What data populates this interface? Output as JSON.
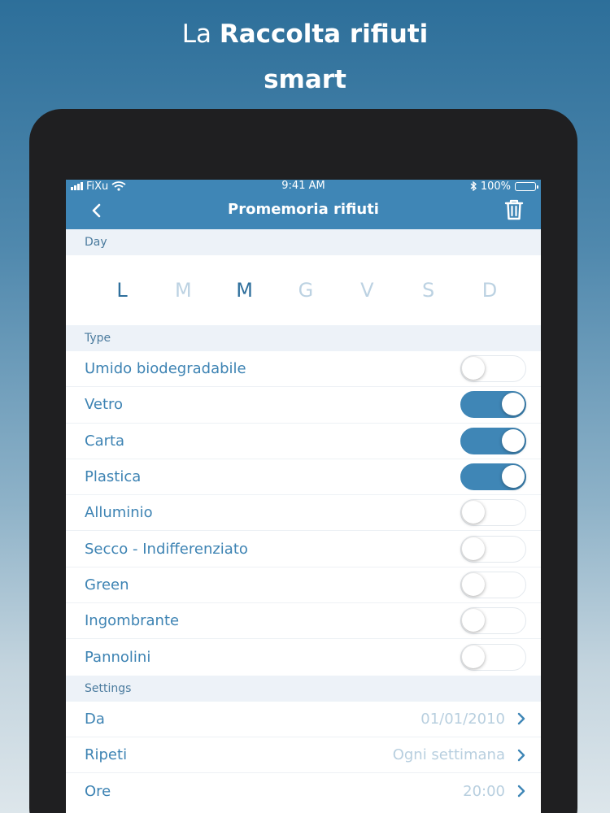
{
  "headline": {
    "light": "La",
    "bold": "Raccolta rifiuti",
    "line2": "smart"
  },
  "status": {
    "carrier": "FiXu",
    "time": "9:41 AM",
    "battery": "100%"
  },
  "nav": {
    "title": "Promemoria rifiuti"
  },
  "sections": {
    "day": "Day",
    "type": "Type",
    "settings": "Settings"
  },
  "days": [
    {
      "letter": "L",
      "active": true
    },
    {
      "letter": "M",
      "active": false
    },
    {
      "letter": "M",
      "active": true
    },
    {
      "letter": "G",
      "active": false
    },
    {
      "letter": "V",
      "active": false
    },
    {
      "letter": "S",
      "active": false
    },
    {
      "letter": "D",
      "active": false
    }
  ],
  "types": [
    {
      "label": "Umido biodegradabile",
      "on": false
    },
    {
      "label": "Vetro",
      "on": true
    },
    {
      "label": "Carta",
      "on": true
    },
    {
      "label": "Plastica",
      "on": true
    },
    {
      "label": "Alluminio",
      "on": false
    },
    {
      "label": "Secco - Indifferenziato",
      "on": false
    },
    {
      "label": "Green",
      "on": false
    },
    {
      "label": "Ingombrante",
      "on": false
    },
    {
      "label": "Pannolini",
      "on": false
    }
  ],
  "settings": [
    {
      "label": "Da",
      "value": "01/01/2010"
    },
    {
      "label": "Ripeti",
      "value": "Ogni settimana"
    },
    {
      "label": "Ore",
      "value": "20:00"
    }
  ],
  "colors": {
    "accent": "#3f86b6",
    "text": "#3d83b3",
    "inactive_day": "#bcd2e2",
    "active_day": "#2f6f9c",
    "section_bg": "#edf2f8"
  }
}
